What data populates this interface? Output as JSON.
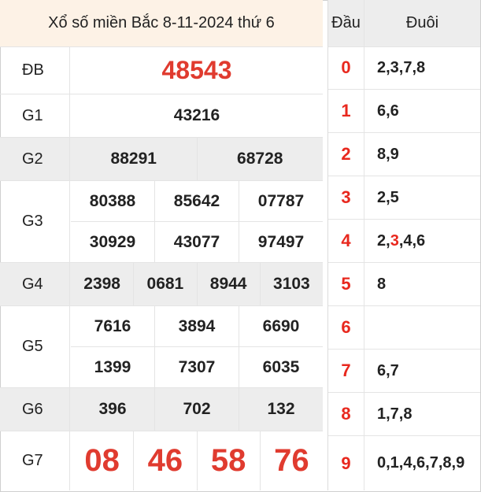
{
  "title": "Xổ số miền Bắc 8-11-2024 thứ 6",
  "prizes": {
    "db": {
      "label": "ĐB",
      "numbers": [
        "48543"
      ]
    },
    "g1": {
      "label": "G1",
      "numbers": [
        "43216"
      ]
    },
    "g2": {
      "label": "G2",
      "numbers": [
        "88291",
        "68728"
      ]
    },
    "g3": {
      "label": "G3",
      "numbers": [
        "80388",
        "85642",
        "07787",
        "30929",
        "43077",
        "97497"
      ]
    },
    "g4": {
      "label": "G4",
      "numbers": [
        "2398",
        "0681",
        "8944",
        "3103"
      ]
    },
    "g5": {
      "label": "G5",
      "numbers": [
        "7616",
        "3894",
        "6690",
        "1399",
        "7307",
        "6035"
      ]
    },
    "g6": {
      "label": "G6",
      "numbers": [
        "396",
        "702",
        "132"
      ]
    },
    "g7": {
      "label": "G7",
      "numbers": [
        "08",
        "46",
        "58",
        "76"
      ]
    }
  },
  "loto": {
    "head_label": "Đầu",
    "tail_label": "Đuôi",
    "rows": [
      {
        "dau": "0",
        "duoi": "2,3,7,8"
      },
      {
        "dau": "1",
        "duoi": "6,6"
      },
      {
        "dau": "2",
        "duoi": "8,9"
      },
      {
        "dau": "3",
        "duoi": "2,5"
      },
      {
        "dau": "4",
        "duoi_pre": "2,",
        "duoi_hl": "3",
        "duoi_post": ",4,6"
      },
      {
        "dau": "5",
        "duoi": "8"
      },
      {
        "dau": "6",
        "duoi": ""
      },
      {
        "dau": "7",
        "duoi": "6,7"
      },
      {
        "dau": "8",
        "duoi": "1,7,8"
      },
      {
        "dau": "9",
        "duoi": "0,1,4,6,7,8,9"
      }
    ]
  },
  "colors": {
    "highlight": "#e03b2f",
    "title_bg": "#fdf2e6",
    "shaded_bg": "#ededed"
  }
}
